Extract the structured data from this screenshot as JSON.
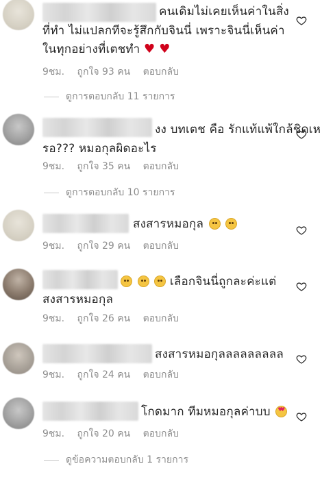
{
  "comments": [
    {
      "line1": "คนเดิมไม่เคยเห็นค่าในสิ่ง",
      "line2": "ที่ทำ ไม่แปลกทีจะรู้สึกกับจินนี่ เพราะจินนี่เห็นค่า",
      "line3": "ในทุกอย่างที่เตชทำ",
      "line3_emoji": "❤️ ❤️",
      "time": "9ชม.",
      "likes": "ถูกใจ 93 คน",
      "reply": "ตอบกลับ",
      "view_replies": "ดูการตอบกลับ 11 รายการ"
    },
    {
      "line1": "งง บทเตช คือ รักแท้แพ้ใกล้ชิดเห",
      "line2": "รอ??? หมอกุลผิดอะไร",
      "time": "9ชม.",
      "likes": "ถูกใจ 35 คน",
      "reply": "ตอบกลับ",
      "view_replies": "ดูการตอบกลับ 10 รายการ"
    },
    {
      "line1": "สงสารหมอกุล",
      "line1_emoji": "😢 😢",
      "time": "9ชม.",
      "likes": "ถูกใจ 29 คน",
      "reply": "ตอบกลับ"
    },
    {
      "line1_emoji": "😢 😢 😢",
      "line1": "เลือกจินนี่ถูกละค่ะแต่",
      "line2": "สงสารหมอกุล",
      "time": "9ชม.",
      "likes": "ถูกใจ 26 คน",
      "reply": "ตอบกลับ"
    },
    {
      "line1": "สงสารหมอกุลลลลลลลลล",
      "time": "9ชม.",
      "likes": "ถูกใจ 24 คน",
      "reply": "ตอบกลับ"
    },
    {
      "line1": "โกดมาก ทีมหมอกุลค่าบบ",
      "line1_emoji": "😍",
      "time": "9ชม.",
      "likes": "ถูกใจ 20 คน",
      "reply": "ตอบกลับ",
      "view_replies": "ดูข้อความตอบกลับ 1 รายการ"
    }
  ],
  "icons": {
    "like": "heart-outline-icon",
    "cry": "crying-face-icon",
    "love": "heart-eyes-icon",
    "red_heart": "red-heart-icon"
  }
}
